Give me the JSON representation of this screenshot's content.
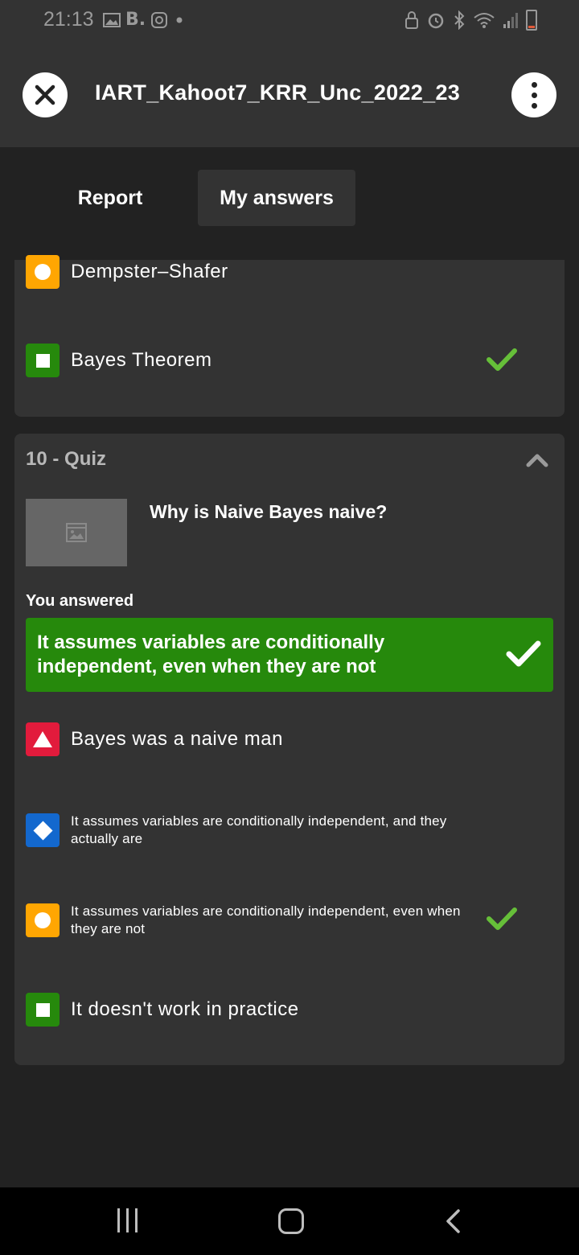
{
  "status_bar": {
    "time": "21:13",
    "left_icons": [
      "image-icon",
      "b-icon",
      "instagram-icon",
      "dot-icon"
    ],
    "right_icons": [
      "lock-icon",
      "alarm-icon",
      "bluetooth-icon",
      "wifi-icon",
      "signal-icon",
      "battery-icon"
    ],
    "brand_letter": "B."
  },
  "header": {
    "title": "IART_Kahoot7_KRR_Unc_2022_23"
  },
  "tabs": [
    {
      "label": "Report",
      "active": false
    },
    {
      "label": "My answers",
      "active": true
    }
  ],
  "previous_card": {
    "options": [
      {
        "shape": "circle",
        "color": "#ffa602",
        "text": "Dempster–Shafer",
        "correct": false
      },
      {
        "shape": "square",
        "color": "#26890c",
        "text": "Bayes Theorem",
        "correct": true
      }
    ]
  },
  "quiz": {
    "label": "10 - Quiz",
    "question": "Why is Naive Bayes naive?",
    "you_answered_label": "You answered",
    "answer": "It assumes variables are conditionally independent, even when they are not",
    "options": [
      {
        "shape": "triangle",
        "color": "#e21b3c",
        "text": "Bayes was a naive man",
        "correct": false
      },
      {
        "shape": "diamond",
        "color": "#1368ce",
        "text": "It assumes variables are conditionally independent, and they actually are",
        "correct": false
      },
      {
        "shape": "circle",
        "color": "#ffa602",
        "text": "It assumes variables are conditionally independent, even when they are not",
        "correct": true
      },
      {
        "shape": "square",
        "color": "#26890c",
        "text": "It doesn't work in practice",
        "correct": false
      }
    ]
  },
  "colors": {
    "background": "#222222",
    "card": "#333333",
    "correct_green": "#26890c",
    "check_green": "#66bf39"
  }
}
